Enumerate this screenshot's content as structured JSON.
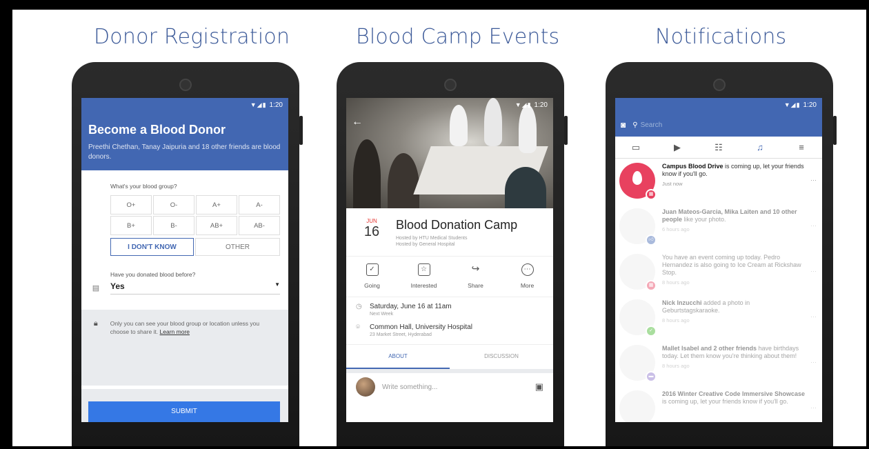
{
  "panels": [
    {
      "title": "Donor Registration"
    },
    {
      "title": "Blood Camp Events"
    },
    {
      "title": "Notifications"
    }
  ],
  "status_time": "1:20",
  "donor": {
    "heading": "Become a Blood Donor",
    "subtext": "Preethi Chethan, Tanay Jaipuria and 18 other friends are blood donors.",
    "blood_group_question": "What's your blood group?",
    "groups": [
      "O+",
      "O-",
      "A+",
      "A-",
      "B+",
      "B-",
      "AB+",
      "AB-"
    ],
    "dont_know": "I DON'T KNOW",
    "other": "OTHER",
    "donated_question": "Have you donated blood before?",
    "donated_value": "Yes",
    "privacy_text": "Only you can see your blood group or location unless you choose to share it.",
    "learn_more": "Learn more",
    "submit": "SUBMIT"
  },
  "event": {
    "month": "JUN",
    "day": "16",
    "title": "Blood Donation Camp",
    "hosted1": "Hosted by HTU Medical Students",
    "hosted2": "Hosted by General Hospital",
    "actions": [
      {
        "label": "Going",
        "icon": "check-calendar-icon"
      },
      {
        "label": "Interested",
        "icon": "star-calendar-icon"
      },
      {
        "label": "Share",
        "icon": "share-icon"
      },
      {
        "label": "More",
        "icon": "more-icon"
      }
    ],
    "when": "Saturday, June 16 at 11am",
    "when_sub": "Next Week",
    "where": "Common Hall, University Hospital",
    "where_sub": "23 Market Street, Hyderabad",
    "tab_about": "ABOUT",
    "tab_discussion": "DISCUSSION",
    "compose_placeholder": "Write something..."
  },
  "notifications": {
    "search_placeholder": "Search",
    "items": [
      {
        "bold": "Campus Blood Drive",
        "text": " is coming up, let your friends know if you'll go.",
        "time": "Just now",
        "badge_color": "#e8415f"
      },
      {
        "bold": "Juan Mateos-Garcia, Mika Laiten and 10 other people",
        "text": " like your photo.",
        "time": "6 hours ago",
        "badge_color": "#4267b2"
      },
      {
        "bold": "",
        "text": "You have an event coming up today. Pedro Hernandez is also going to Ice Cream at Rickshaw Stop.",
        "time": "8 hours ago",
        "badge_color": "#e8415f"
      },
      {
        "bold": "Nick Inzucchi",
        "text": " added a photo in Geburtstagskaraoke.",
        "time": "8 hours ago",
        "badge_color": "#42b72a"
      },
      {
        "bold": "Mallet Isabel and 2 other friends",
        "text": " have birthdays today. Let them know you're thinking about them!",
        "time": "8 hours ago",
        "badge_color": "#8c72cb"
      },
      {
        "bold": "2016 Winter Creative Code Immersive Showcase",
        "text": " is coming up, let your friends know if you'll go.",
        "time": "",
        "badge_color": "#e8415f"
      }
    ]
  }
}
